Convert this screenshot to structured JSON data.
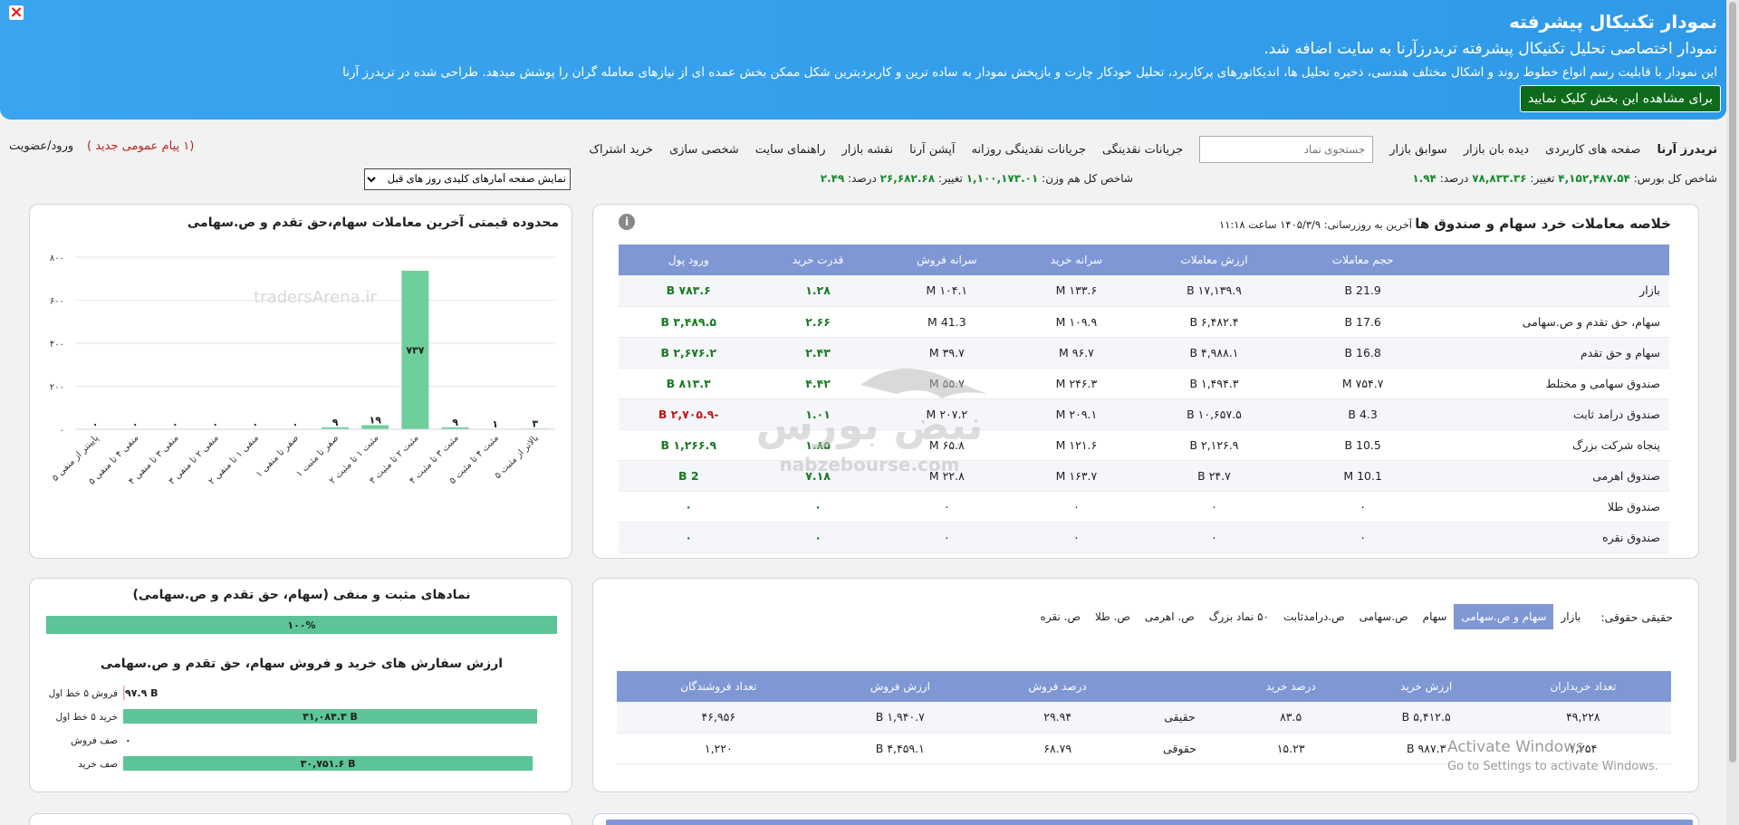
{
  "banner": {
    "title": "نمودار تکنیکال پیشرفته",
    "subtitle": "نمودار اختصاصی تحلیل تکنیکال پیشرفته تریدرزآرنا به سایت اضافه شد.",
    "desc": "این نمودار با قابلیت رسم انواع خطوط روند و اشکال مختلف هندسی، ذخیره تحلیل ها، اندیکاتورهای پرکاربرد، تحلیل خودکار چارت و بازپخش نمودار به ساده ترین و کاربردیترین شکل ممکن بخش عمده ای از نیازهای معامله گران را پوشش میدهد. طراحی شده در تریدرز آرنا",
    "button": "برای مشاهده این بخش کلیک نمایید",
    "close": "×"
  },
  "nav": {
    "items": [
      "تریدرز آرنا",
      "صفحه های کاربردی",
      "دیده بان بازار",
      "سوابق بازار"
    ],
    "items2": [
      "جریانات نقدینگی",
      "جریانات نقدینگی روزانه",
      "آپشن آرنا",
      "نقشه بازار",
      "راهنمای سایت",
      "شخصی سازی",
      "خرید اشتراک"
    ],
    "search_placeholder": "جستجوی نماد",
    "login": "ورود/عضویت",
    "messages": "(۱ پیام عمومی جدید )"
  },
  "index": {
    "total_label": "شاخص کل بورس:",
    "total_value": "۴,۱۵۲,۴۸۷.۵۴",
    "total_change_label": "تغییر:",
    "total_change": "۷۸,۸۳۳.۳۶",
    "total_pct_label": "درصد:",
    "total_pct": "۱.۹۴",
    "eq_label": "شاخص کل هم وزن:",
    "eq_value": "۱,۱۰۰,۱۷۳.۰۱",
    "eq_change_label": "تغییر:",
    "eq_change": "۲۶,۶۸۲.۶۸",
    "eq_pct_label": "درصد:",
    "eq_pct": "۲.۴۹",
    "select": "نمایش صفحه آمارهای کلیدی روز های قبل"
  },
  "summary": {
    "title": "خلاصه معاملات خرد سهام و صندوق ها",
    "updated": "آخرین به روزرسانی: ۱۴۰۵/۳/۹ ساعت ۱۱:۱۸",
    "headers": [
      "",
      "حجم معاملات",
      "ارزش معاملات",
      "سرانه خرید",
      "سرانه فروش",
      "قدرت خرید",
      "ورود پول"
    ],
    "rows": [
      [
        "بازار",
        "21.9 B",
        "۱۷,۱۳۹.۹ B",
        "۱۳۳.۶ M",
        "۱۰۴.۱ M",
        "۱.۲۸",
        "۷۸۳.۶ B"
      ],
      [
        "سهام، حق تقدم و ص.سهامی",
        "17.6 B",
        "۶,۴۸۲.۴ B",
        "۱۰۹.۹ M",
        "41.3 M",
        "۲.۶۶",
        "۳,۴۸۹.۵ B"
      ],
      [
        "سهام و حق تقدم",
        "16.8 B",
        "۴,۹۸۸.۱ B",
        "۹۶.۷ M",
        "۳۹.۷ M",
        "۲.۴۳",
        "۲,۶۷۶.۲ B"
      ],
      [
        "صندوق سهامی و مختلط",
        "۷۵۴.۷ M",
        "۱,۴۹۴.۳ B",
        "۲۴۶.۳ M",
        "۵۵.۷ M",
        "۴.۴۲",
        "۸۱۳.۳ B"
      ],
      [
        "صندوق درامد ثابت",
        "4.3 B",
        "۱۰,۶۵۷.۵ B",
        "۲۰۹.۱ M",
        "۲۰۷.۲ M",
        "۱.۰۱",
        "-۲,۷۰۵.۹ B"
      ],
      [
        "پنجاه شرکت بزرگ",
        "10.5 B",
        "۲,۱۲۶.۹ B",
        "۱۲۱.۶ M",
        "۶۵.۸ M",
        "۱.۸۵",
        "۱,۲۶۶.۹ B"
      ],
      [
        "صندوق اهرمی",
        "10.1 M",
        "۲۴.۷ B",
        "۱۶۳.۷ M",
        "۲۲.۸ M",
        "۷.۱۸",
        "2 B"
      ],
      [
        "صندوق طلا",
        "۰",
        "۰",
        "۰",
        "۰",
        "۰",
        "۰"
      ],
      [
        "صندوق نقره",
        "۰",
        "۰",
        "۰",
        "۰",
        "۰",
        "۰"
      ]
    ],
    "info_icon": "i"
  },
  "tabs": {
    "label": "حقیقی حقوقی:",
    "items": [
      "بازار",
      "سهام و ص.سهامی",
      "سهام",
      "ص.سهامی",
      "ص.درامدثابت",
      "۵۰ نماد بزرگ",
      "ص. اهرمی",
      "ص. طلا",
      "ص. نقره"
    ],
    "active": 1
  },
  "hoghoghi": {
    "headers": [
      "تعداد خریداران",
      "ارزش خرید",
      "درصد خرید",
      "",
      "درصد فروش",
      "ارزش فروش",
      "تعداد فروشندگان"
    ],
    "rows": [
      [
        "۴۹,۲۲۸",
        "۵,۴۱۲.۵ B",
        "۸۳.۵",
        "حقیقی",
        "۲۹.۹۴",
        "۱,۹۴۰.۷ B",
        "۴۶,۹۵۶"
      ],
      [
        "۱,۲۵۴",
        "۹۸۷.۳ B",
        "۱۵.۲۳",
        "حقوقی",
        "۶۸.۷۹",
        "۴,۴۵۹.۱ B",
        "۱,۲۲۰"
      ]
    ]
  },
  "range_chart": {
    "title": "محدوده قیمتی آخرین معاملات سهام،حق تقدم و ص.سهامی",
    "watermark": "tradersArena.ir"
  },
  "chart_data": [
    {
      "type": "bar",
      "title": "محدوده قیمتی آخرین معاملات سهام،حق تقدم و ص.سهامی",
      "categories": [
        "پایینتر از منفی ۵",
        "منفی ۴ تا منفی ۵",
        "منفی ۳ تا منفی ۴",
        "منفی ۲ تا منفی ۳",
        "منفی ۱ تا منفی ۲",
        "صفر تا منفی ۱",
        "صفر تا مثبت ۱",
        "مثبت ۱ تا مثبت ۲",
        "مثبت ۲ تا مثبت ۳",
        "مثبت ۳ تا مثبت ۴",
        "مثبت ۴ تا مثبت ۵",
        "بالاتر از مثبت ۵"
      ],
      "values": [
        0,
        0,
        0,
        0,
        0,
        0,
        9,
        19,
        737,
        9,
        1,
        3
      ],
      "labels": [
        "۰",
        "۰",
        "۰",
        "۰",
        "۰",
        "۰",
        "۹",
        "۱۹",
        "۷۳۷",
        "۹",
        "۱",
        "۳"
      ],
      "yticks": [
        "۸۰۰",
        "۶۰۰",
        "۴۰۰",
        "۲۰۰",
        "۰"
      ],
      "ylim": [
        0,
        800
      ],
      "color": "#6fcf9c"
    },
    {
      "type": "bar",
      "title": "نمادهای مثبت و منفی (سهام، حق تقدم و ص.سهامی)",
      "values": [
        100
      ],
      "labels": [
        "۱۰۰%"
      ]
    },
    {
      "type": "bar",
      "title": "ارزش سفارش های خرید و فروش سهام، حق تقدم و ص.سهامی",
      "categories": [
        "فروش ۵ خط اول",
        "خرید ۵ خط اول",
        "صف فروش",
        "صف خرید"
      ],
      "values": [
        97.9,
        31084.3,
        0,
        30751.6
      ],
      "labels": [
        "۹۷.۹ B",
        "۳۱,۰۸۴.۳ B",
        "۰",
        "۳۰,۷۵۱.۶ B"
      ]
    }
  ],
  "posneg": {
    "title": "نمادهای مثبت و منفی (سهام، حق تقدم و ص.سهامی)",
    "pct": "۱۰۰%"
  },
  "orders": {
    "title": "ارزش سفارش های خرید و فروش سهام، حق تقدم و ص.سهامی"
  },
  "watermark": {
    "brand": "نبض بورس",
    "url": "nabzebourse.com"
  },
  "activate": {
    "title": "Activate Windows",
    "sub": "Go to Settings to activate Windows."
  },
  "colors": {
    "accent": "#7f97d4",
    "green": "#6fcf9c",
    "banner": "#3aa4ee"
  }
}
